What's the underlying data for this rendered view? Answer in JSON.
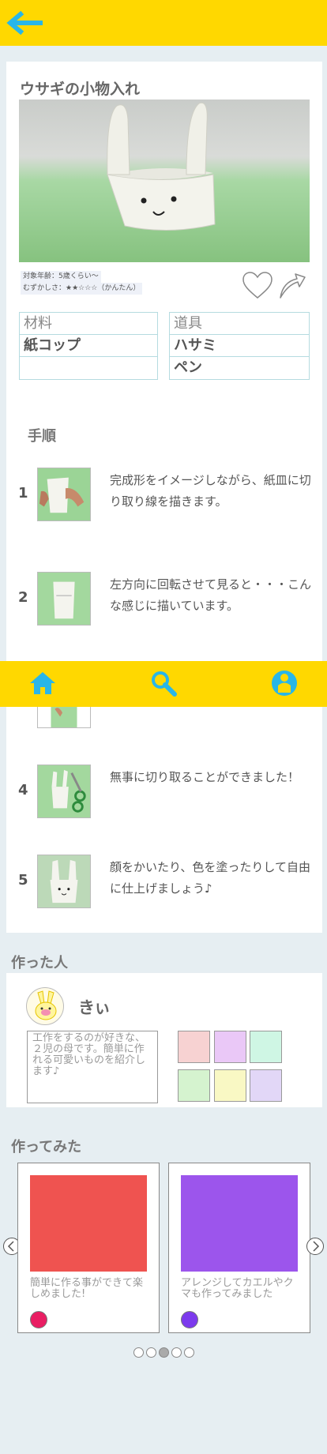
{
  "header": {
    "back_icon": "arrow-left-icon"
  },
  "craft": {
    "title": "ウサギの小物入れ",
    "age": "対象年齢：5歳くらい〜",
    "difficulty": "むずかしさ：★★☆☆☆（かんたん）",
    "favorite_icon": "heart-outline-icon",
    "share_icon": "share-arrow-icon"
  },
  "materials": {
    "heading": "材料",
    "items": [
      "紙コップ",
      ""
    ]
  },
  "tools": {
    "heading": "道具",
    "items": [
      "ハサミ",
      "ペン"
    ]
  },
  "steps_heading": "手順",
  "steps": [
    {
      "num": "1",
      "text": "完成形をイメージしながら、紙皿に切り取り線を描きます。"
    },
    {
      "num": "2",
      "text": "左方向に回転させて見ると・・・こんな感じに描いています。"
    },
    {
      "num": "4",
      "text": "無事に切り取ることができました！"
    },
    {
      "num": "5",
      "text": "顔をかいたり、色を塗ったりして自由に仕上げましょう♪"
    }
  ],
  "nav": {
    "home_icon": "home-icon",
    "search_icon": "search-icon",
    "profile_icon": "user-icon"
  },
  "maker": {
    "heading": "作った人",
    "name": "きぃ",
    "bio": "工作をするのが好きな、２児の母です。簡単に作れる可愛いものを紹介します♪",
    "swatches": [
      "#f7d2d2",
      "#eac8f7",
      "#cff6e4",
      "#d5f3cf",
      "#f9f8c4",
      "#e2d7f7"
    ]
  },
  "tried": {
    "heading": "作ってみた",
    "cards": [
      {
        "text": "簡単に作る事ができて楽しめました!",
        "image_color": "#ef5350",
        "dot_color": "#e91e63"
      },
      {
        "text": "アレンジしてカエルやクマも作ってみました",
        "image_color": "#9c55ec",
        "dot_color": "#7c3aed"
      }
    ],
    "pager": {
      "count": 5,
      "active": 3
    }
  },
  "colors": {
    "accent": "#ffd800",
    "icon_blue": "#29b6e8"
  }
}
